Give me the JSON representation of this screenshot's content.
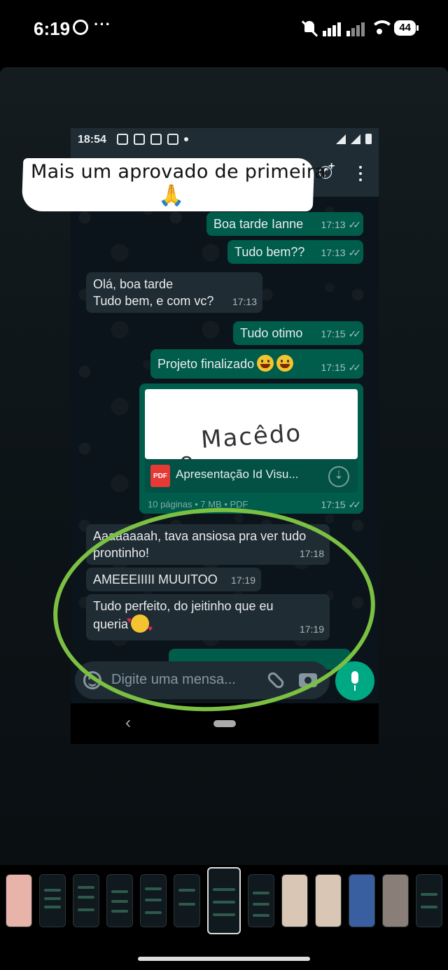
{
  "outer_status": {
    "time": "6:19",
    "extra": "···",
    "battery": "44"
  },
  "story": {
    "caption": "Mais um aprovado de primeira",
    "caption_emoji": "🙏"
  },
  "inner_status": {
    "time": "18:54"
  },
  "messages": [
    {
      "dir": "out",
      "text": "Boa tarde Ianne",
      "time": "17:13"
    },
    {
      "dir": "out",
      "text": "Tudo bem??",
      "time": "17:13"
    },
    {
      "dir": "in",
      "text": "Olá, boa tarde\nTudo bem, e com vc?",
      "time": "17:13"
    },
    {
      "dir": "out",
      "text": "Tudo otimo",
      "time": "17:15"
    },
    {
      "dir": "out",
      "text": "Projeto finalizado",
      "time": "17:15"
    },
    {
      "dir": "in",
      "text": "Aaaaaaaah, tava ansiosa pra ver tudo\nprontinho!",
      "time": "17:18"
    },
    {
      "dir": "in",
      "text": "AMEEEIIIII MUUITOO",
      "time": "17:19"
    },
    {
      "dir": "in",
      "text": "Tudo perfeito, do jeitinho que eu\nqueria",
      "time": "17:19"
    }
  ],
  "document": {
    "preview_text": "Macêdo",
    "preview_prefix": "e",
    "file_badge": "PDF",
    "file_name": "Apresentação Id Visu...",
    "file_meta": "10 páginas • 7 MB • PDF",
    "time": "17:15"
  },
  "composer": {
    "placeholder": "Digite uma mensa..."
  },
  "nav": {
    "back": "‹"
  },
  "colors": {
    "outgoing": "#005c4b",
    "incoming": "#202c33",
    "accent": "#00a884",
    "ring": "#7bc043"
  }
}
